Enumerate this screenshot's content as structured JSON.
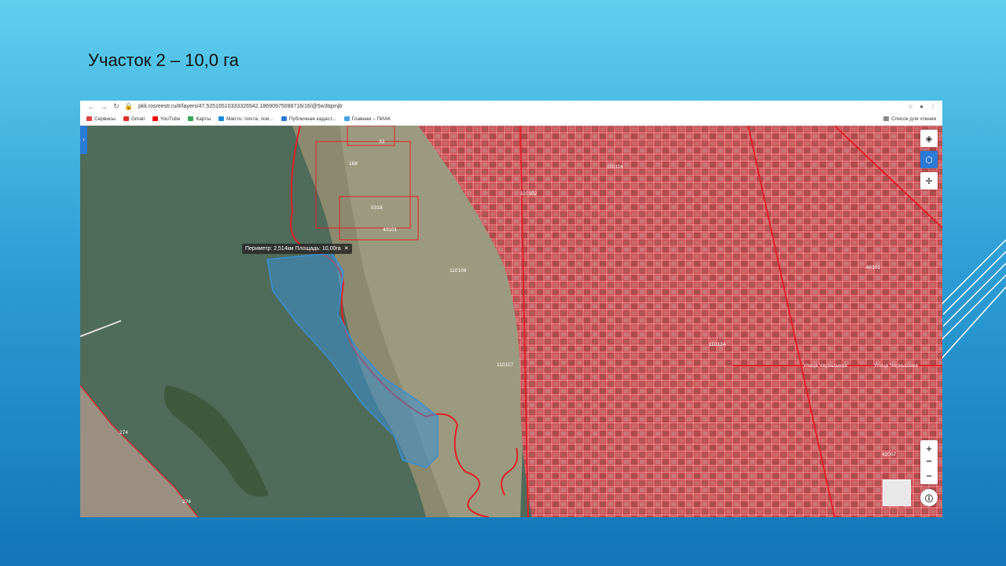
{
  "slide": {
    "title": "Участок 2 – 10,0 га"
  },
  "browser": {
    "url": "pkk.rosreestr.ru/#/layers/47.52516510333326542.18690975098716/16/@5w3tqxnjb",
    "bookmarks": [
      {
        "label": "Сервисы",
        "icon": "apps-icon",
        "color": "#e04040"
      },
      {
        "label": "Gmail",
        "icon": "gmail-icon",
        "color": "#d93025"
      },
      {
        "label": "YouTube",
        "icon": "youtube-icon",
        "color": "#ff0000"
      },
      {
        "label": "Карты",
        "icon": "maps-icon",
        "color": "#34a853"
      },
      {
        "label": "Mail.ru: почта, пои...",
        "icon": "mailru-icon",
        "color": "#168de2"
      },
      {
        "label": "Публичная кадаст...",
        "icon": "pkk-icon",
        "color": "#2b7bd6"
      },
      {
        "label": "Главная – ПИАК",
        "icon": "piak-icon",
        "color": "#4aa3df"
      }
    ],
    "reading_list": "Список для чтения"
  },
  "map": {
    "measure_tooltip": "Периметр: 2,514км Площадь: 10,00га",
    "labels": [
      {
        "t": "33"
      },
      {
        "t": "168"
      },
      {
        "t": "5318"
      },
      {
        "t": "40101"
      },
      {
        "t": "274"
      },
      {
        "t": "274"
      },
      {
        "t": "110102"
      },
      {
        "t": "110114"
      },
      {
        "t": "110108"
      },
      {
        "t": "110124"
      },
      {
        "t": "110107"
      },
      {
        "t": "40101"
      },
      {
        "t": "42007"
      },
      {
        "t": "Улица Чернышева"
      },
      {
        "t": "Улица Чернышева"
      }
    ],
    "zoom_in": "+",
    "zoom_out": "−",
    "zoom_more": "•••"
  },
  "colors": {
    "accent": "#2b7bd6",
    "parcel_line": "#e0202a",
    "selection": "#3a8fd0"
  }
}
